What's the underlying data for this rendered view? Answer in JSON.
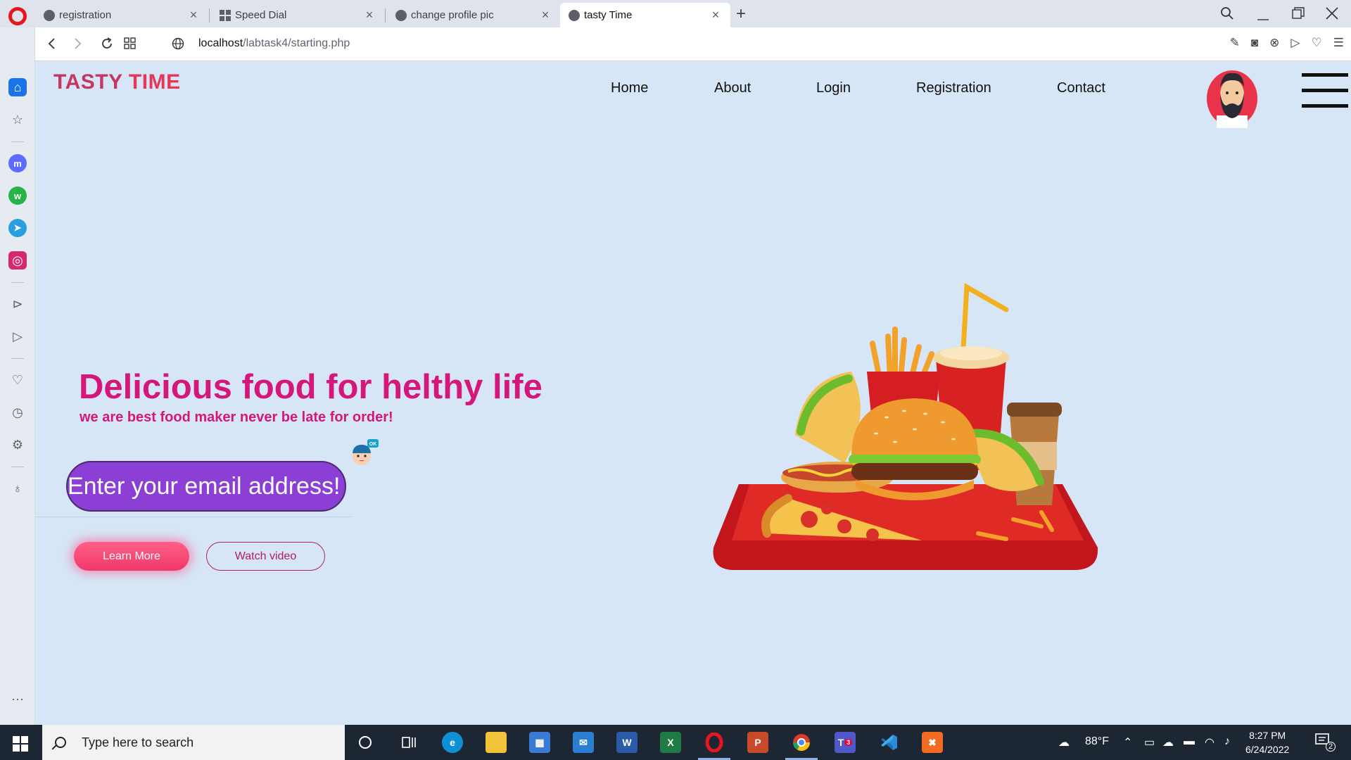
{
  "browser": {
    "tabs": [
      {
        "title": "registration",
        "active": false
      },
      {
        "title": "Speed Dial",
        "active": false
      },
      {
        "title": "change profile pic",
        "active": false
      },
      {
        "title": "tasty Time",
        "active": true
      }
    ],
    "url_host": "localhost",
    "url_path": "/labtask4/starting.php",
    "new_tab_label": "+"
  },
  "site": {
    "logo_first": "TASTY",
    "logo_second": "TIME",
    "nav": [
      "Home",
      "About",
      "Login",
      "Registration",
      "Contact"
    ],
    "headline": "Delicious food for helthy life",
    "subhead": "we are best food maker never be late for order!",
    "email_placeholder": "Enter your email address!",
    "sticker_badge": "OK",
    "learn_more": "Learn More",
    "watch_video": "Watch video"
  },
  "taskbar": {
    "search_placeholder": "Type here to search",
    "weather": "88°F",
    "time": "8:27 PM",
    "date": "6/24/2022",
    "teams_badge": "3",
    "notification_count": "2"
  },
  "colors": {
    "page_bg": "#d6e6f6",
    "headline": "#d4177a",
    "email_input": "#8b3fd4",
    "learn_more_button": "#f0386a",
    "logo": "#c7365f"
  }
}
